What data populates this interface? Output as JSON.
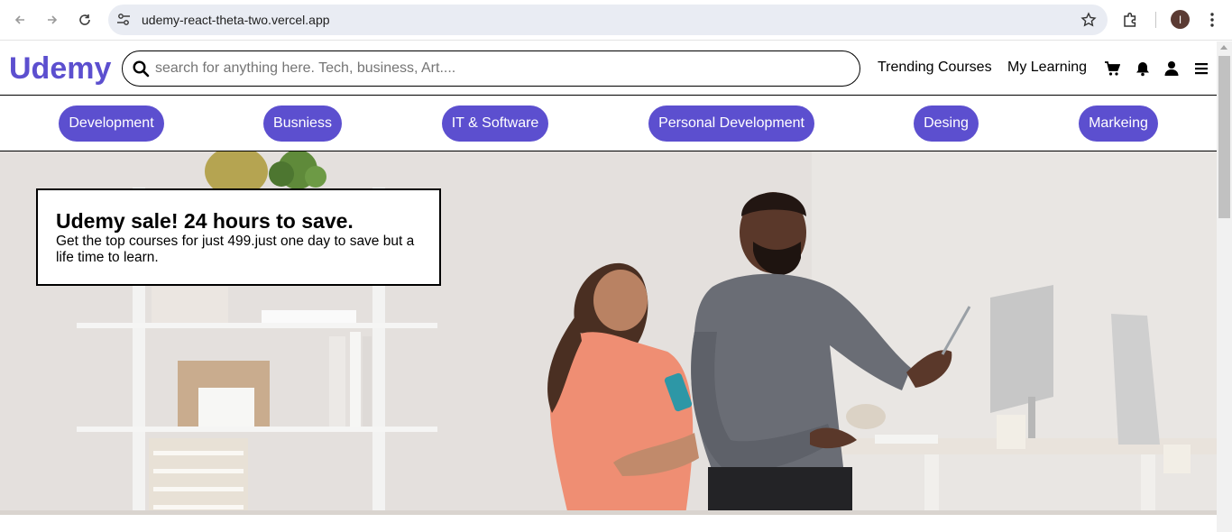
{
  "browser": {
    "url": "udemy-react-theta-two.vercel.app",
    "avatar_letter": "I"
  },
  "header": {
    "logo": "Udemy",
    "search_placeholder": "search for anything here. Tech, business, Art....",
    "links": [
      "Trending Courses",
      "My Learning"
    ],
    "icons": [
      "cart-icon",
      "bell-icon",
      "user-icon",
      "menu-icon"
    ]
  },
  "categories": [
    "Development",
    "Busniess",
    "IT & Software",
    "Personal Development",
    "Desing",
    "Markeing"
  ],
  "hero": {
    "title": "Udemy sale! 24 hours to save.",
    "text": "Get the top courses for just 499.just one day to save but a life time to learn."
  },
  "colors": {
    "brand": "#5c4fcf"
  }
}
